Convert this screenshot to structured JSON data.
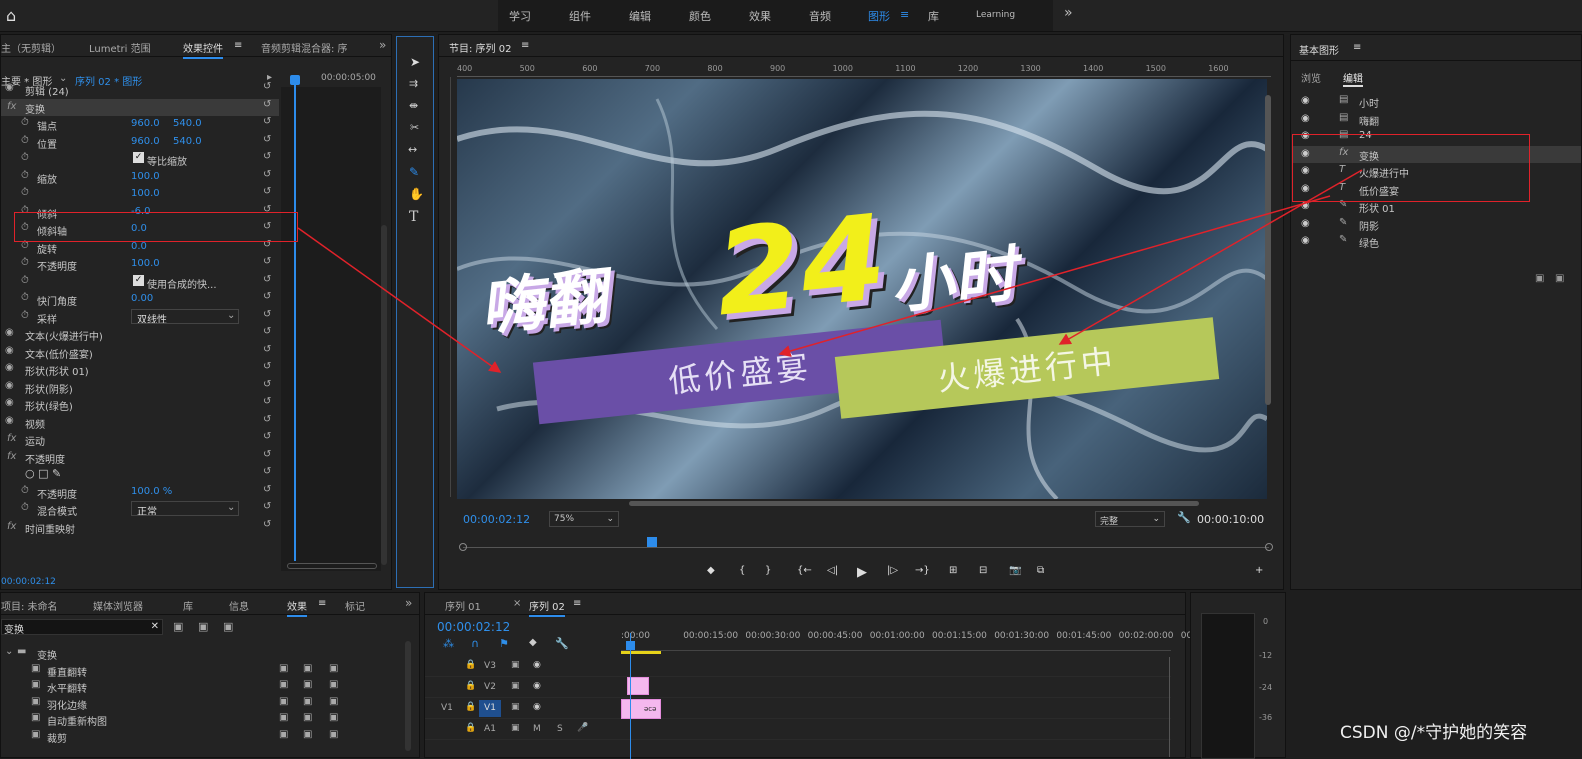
{
  "topbar": {
    "home": "⌂",
    "workspaces": [
      "学习",
      "组件",
      "编辑",
      "颜色",
      "效果",
      "音频",
      "图形",
      "库",
      "Learning"
    ],
    "active_menu": "≡",
    "more": "»"
  },
  "effect_controls": {
    "tabs": [
      "主（无剪辑）",
      "Lumetri 范围",
      "效果控件",
      "音频剪辑混合器: 序"
    ],
    "active_menu": "≡",
    "more": "»",
    "source_label": "主要 * 图形",
    "sequence_label": "序列 02 * 图形",
    "timecode_top": "00:00:05:00",
    "rows": [
      {
        "name": "剪辑 (24)"
      },
      {
        "name": "变换",
        "fx": "fx"
      },
      {
        "name": "锚点",
        "v1": "960.0",
        "v2": "540.0"
      },
      {
        "name": "位置",
        "v1": "960.0",
        "v2": "540.0"
      },
      {
        "name": "等比缩放",
        "check": "✓"
      },
      {
        "name": "缩放",
        "v1": "100.0"
      },
      {
        "name": "",
        "v1": "100.0"
      },
      {
        "name": "倾斜",
        "v1": "-6.0"
      },
      {
        "name": "倾斜轴",
        "v1": "0.0"
      },
      {
        "name": "旋转",
        "v1": "0.0"
      },
      {
        "name": "不透明度",
        "v1": "100.0"
      },
      {
        "name": "使用合成的快...",
        "check": "✓"
      },
      {
        "name": "快门角度",
        "v1": "0.00"
      },
      {
        "name": "采样",
        "v1": "双线性"
      },
      {
        "name": "文本(火爆进行中)"
      },
      {
        "name": "文本(低价盛宴)"
      },
      {
        "name": "形状(形状 01)"
      },
      {
        "name": "形状(阴影)"
      },
      {
        "name": "形状(绿色)"
      },
      {
        "name": "视频"
      },
      {
        "name": "运动",
        "fx": "fx"
      },
      {
        "name": "不透明度",
        "fx": "fx"
      },
      {
        "name": "",
        "shapes": "○ □ ✎"
      },
      {
        "name": "不透明度",
        "v1": "100.0 %"
      },
      {
        "name": "混合模式",
        "v1": "正常"
      },
      {
        "name": "时间重映射",
        "fx": "fx"
      }
    ],
    "timecode_bottom": "00:00:02:12"
  },
  "program": {
    "title": "节目: 序列 02",
    "menu": "≡",
    "ruler": [
      "400",
      "500",
      "600",
      "700",
      "800",
      "900",
      "1000",
      "1100",
      "1200",
      "1300",
      "1400",
      "1500",
      "1600"
    ],
    "title_text1": "嗨翻",
    "title_num": "24",
    "title_text2": "小时",
    "banner1": "低价盛宴",
    "banner2": "火爆进行中",
    "timecode": "00:00:02:12",
    "zoom": "75%",
    "quality": "完整",
    "duration": "00:00:10:00",
    "controls": [
      "◆",
      "{",
      "}",
      "{←",
      "◁|",
      "▶",
      "|▷",
      "→}",
      "⊞",
      "⊟",
      "📷",
      "⧉",
      "+"
    ]
  },
  "essential_graphics": {
    "title": "基本图形",
    "menu": "≡",
    "tabs": [
      "浏览",
      "编辑"
    ],
    "layers": [
      {
        "icon": "▤",
        "name": "小时"
      },
      {
        "icon": "▤",
        "name": "嗨翻"
      },
      {
        "icon": "▤",
        "name": "24"
      },
      {
        "icon": "fx",
        "name": "变换"
      },
      {
        "icon": "T",
        "name": "火爆进行中"
      },
      {
        "icon": "T",
        "name": "低价盛宴"
      },
      {
        "icon": "✎",
        "name": "形状 01"
      },
      {
        "icon": "✎",
        "name": "阴影"
      },
      {
        "icon": "✎",
        "name": "绿色"
      }
    ]
  },
  "project": {
    "tabs": [
      "项目: 未命名",
      "媒体浏览器",
      "库",
      "信息",
      "效果",
      "标记"
    ],
    "menu": "≡",
    "more": "»",
    "search_value": "变换",
    "clear": "✕",
    "tree": [
      {
        "name": "变换",
        "type": "folder"
      },
      {
        "name": "垂直翻转",
        "type": "item"
      },
      {
        "name": "水平翻转",
        "type": "item"
      },
      {
        "name": "羽化边缘",
        "type": "item"
      },
      {
        "name": "自动重新构图",
        "type": "item"
      },
      {
        "name": "裁剪",
        "type": "item"
      }
    ]
  },
  "timeline": {
    "tabs": [
      "序列 01",
      "序列 02"
    ],
    "close": "×",
    "menu": "≡",
    "timecode": "00:00:02:12",
    "ruler": [
      ":00:00",
      "00:00:15:00",
      "00:00:30:00",
      "00:00:45:00",
      "00:01:00:00",
      "00:01:15:00",
      "00:01:30:00",
      "00:01:45:00",
      "00:02:00:00",
      "00"
    ],
    "tracks": [
      {
        "src": "",
        "name": "V3"
      },
      {
        "src": "",
        "name": "V2"
      },
      {
        "src": "V1",
        "name": "V1"
      },
      {
        "src": "",
        "name": "A1",
        "m": "M",
        "s": "S"
      }
    ],
    "clip_label": "ǝcə"
  },
  "meter": {
    "ticks": [
      "0",
      "-12",
      "-24",
      "-36"
    ]
  },
  "watermark": "CSDN @/*守护她的笑容",
  "colors": {
    "accent": "#2d8ceb",
    "red": "#e0222a",
    "banner_purple": "#6a4fa7",
    "banner_green": "#b6c85a",
    "title_yellow": "#f2ef1a"
  }
}
